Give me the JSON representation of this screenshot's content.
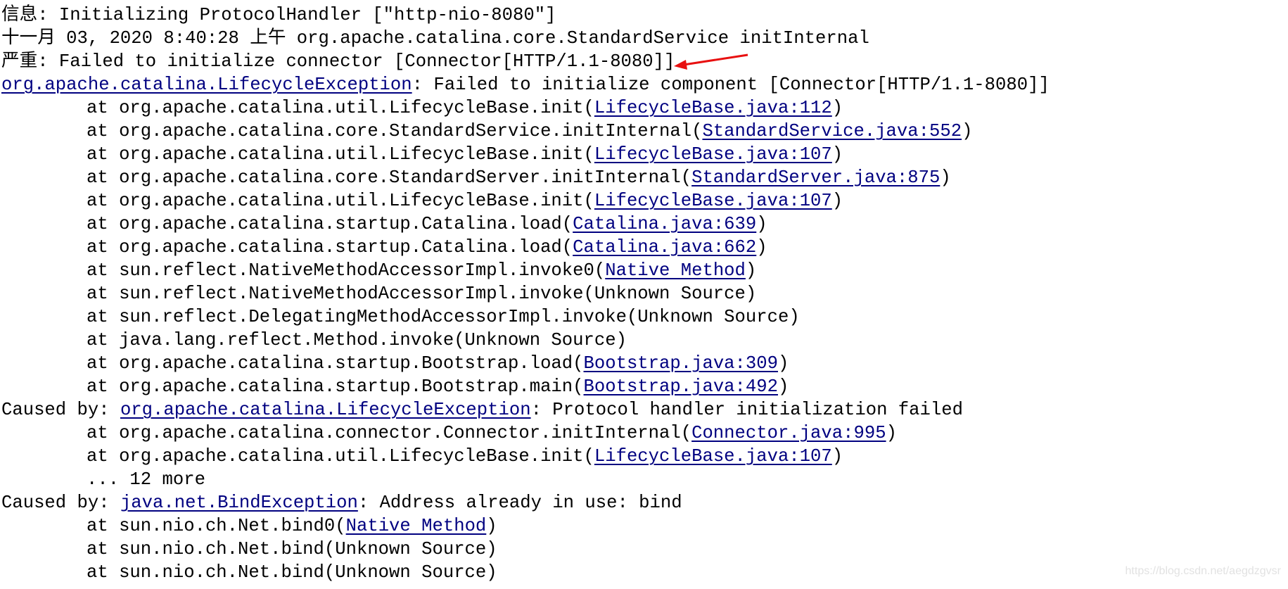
{
  "lines": [
    {
      "indent": false,
      "parts": [
        {
          "text": "信息: Initializing ProtocolHandler [\"http-nio-8080\"]"
        }
      ]
    },
    {
      "indent": false,
      "parts": [
        {
          "text": "十一月 03, 2020 8:40:28 上午 org.apache.catalina.core.StandardService initInternal"
        }
      ]
    },
    {
      "indent": false,
      "parts": [
        {
          "text": "严重: Failed to initialize connector [Connector[HTTP/1.1-8080]]"
        }
      ]
    },
    {
      "indent": false,
      "parts": [
        {
          "text": "org.apache.catalina.LifecycleException",
          "link": true
        },
        {
          "text": ": Failed to initialize component [Connector[HTTP/1.1-8080]]"
        }
      ]
    },
    {
      "indent": true,
      "parts": [
        {
          "text": "at org.apache.catalina.util.LifecycleBase.init("
        },
        {
          "text": "LifecycleBase.java:112",
          "link": true
        },
        {
          "text": ")"
        }
      ]
    },
    {
      "indent": true,
      "parts": [
        {
          "text": "at org.apache.catalina.core.StandardService.initInternal("
        },
        {
          "text": "StandardService.java:552",
          "link": true
        },
        {
          "text": ")"
        }
      ]
    },
    {
      "indent": true,
      "parts": [
        {
          "text": "at org.apache.catalina.util.LifecycleBase.init("
        },
        {
          "text": "LifecycleBase.java:107",
          "link": true
        },
        {
          "text": ")"
        }
      ]
    },
    {
      "indent": true,
      "parts": [
        {
          "text": "at org.apache.catalina.core.StandardServer.initInternal("
        },
        {
          "text": "StandardServer.java:875",
          "link": true
        },
        {
          "text": ")"
        }
      ]
    },
    {
      "indent": true,
      "parts": [
        {
          "text": "at org.apache.catalina.util.LifecycleBase.init("
        },
        {
          "text": "LifecycleBase.java:107",
          "link": true
        },
        {
          "text": ")"
        }
      ]
    },
    {
      "indent": true,
      "parts": [
        {
          "text": "at org.apache.catalina.startup.Catalina.load("
        },
        {
          "text": "Catalina.java:639",
          "link": true
        },
        {
          "text": ")"
        }
      ]
    },
    {
      "indent": true,
      "parts": [
        {
          "text": "at org.apache.catalina.startup.Catalina.load("
        },
        {
          "text": "Catalina.java:662",
          "link": true
        },
        {
          "text": ")"
        }
      ]
    },
    {
      "indent": true,
      "parts": [
        {
          "text": "at sun.reflect.NativeMethodAccessorImpl.invoke0("
        },
        {
          "text": "Native Method",
          "link": true
        },
        {
          "text": ")"
        }
      ]
    },
    {
      "indent": true,
      "parts": [
        {
          "text": "at sun.reflect.NativeMethodAccessorImpl.invoke(Unknown Source)"
        }
      ]
    },
    {
      "indent": true,
      "parts": [
        {
          "text": "at sun.reflect.DelegatingMethodAccessorImpl.invoke(Unknown Source)"
        }
      ]
    },
    {
      "indent": true,
      "parts": [
        {
          "text": "at java.lang.reflect.Method.invoke(Unknown Source)"
        }
      ]
    },
    {
      "indent": true,
      "parts": [
        {
          "text": "at org.apache.catalina.startup.Bootstrap.load("
        },
        {
          "text": "Bootstrap.java:309",
          "link": true
        },
        {
          "text": ")"
        }
      ]
    },
    {
      "indent": true,
      "parts": [
        {
          "text": "at org.apache.catalina.startup.Bootstrap.main("
        },
        {
          "text": "Bootstrap.java:492",
          "link": true
        },
        {
          "text": ")"
        }
      ]
    },
    {
      "indent": false,
      "parts": [
        {
          "text": "Caused by: "
        },
        {
          "text": "org.apache.catalina.LifecycleException",
          "link": true
        },
        {
          "text": ": Protocol handler initialization failed"
        }
      ]
    },
    {
      "indent": true,
      "parts": [
        {
          "text": "at org.apache.catalina.connector.Connector.initInternal("
        },
        {
          "text": "Connector.java:995",
          "link": true
        },
        {
          "text": ")"
        }
      ]
    },
    {
      "indent": true,
      "parts": [
        {
          "text": "at org.apache.catalina.util.LifecycleBase.init("
        },
        {
          "text": "LifecycleBase.java:107",
          "link": true
        },
        {
          "text": ")"
        }
      ]
    },
    {
      "indent": true,
      "parts": [
        {
          "text": "... 12 more"
        }
      ]
    },
    {
      "indent": false,
      "parts": [
        {
          "text": "Caused by: "
        },
        {
          "text": "java.net.BindException",
          "link": true
        },
        {
          "text": ": Address already in use: bind"
        }
      ]
    },
    {
      "indent": true,
      "parts": [
        {
          "text": "at sun.nio.ch.Net.bind0("
        },
        {
          "text": "Native Method",
          "link": true
        },
        {
          "text": ")"
        }
      ]
    },
    {
      "indent": true,
      "parts": [
        {
          "text": "at sun.nio.ch.Net.bind(Unknown Source)"
        }
      ]
    },
    {
      "indent": true,
      "parts": [
        {
          "text": "at sun.nio.ch.Net.bind(Unknown Source)"
        }
      ]
    }
  ],
  "annotation": {
    "arrow_color": "#e81010",
    "arrow_icon": "red-arrow-icon"
  },
  "watermark": "https://blog.csdn.net/aegdzgvsr",
  "colors": {
    "link": "#000080",
    "text": "#000000"
  }
}
